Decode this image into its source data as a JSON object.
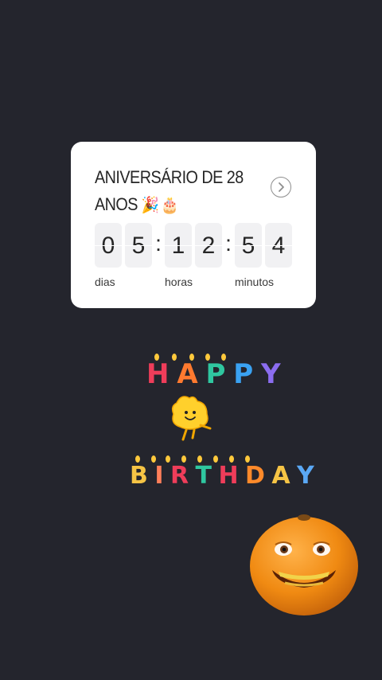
{
  "countdown": {
    "title_line1": "ANIVERSÁRIO DE 28",
    "title_line2": "ANOS",
    "title_emojis": "🎉🎂",
    "digits": [
      "0",
      "5",
      "1",
      "2",
      "5",
      "4"
    ],
    "separator": ":",
    "units": {
      "days": "dias",
      "hours": "horas",
      "minutes": "minutos"
    }
  },
  "stickers": {
    "happy": [
      "H",
      "A",
      "P",
      "P",
      "Y"
    ],
    "birthday": [
      "B",
      "I",
      "R",
      "T",
      "H",
      "D",
      "A",
      "Y"
    ]
  },
  "colors": {
    "background": "#24252d",
    "card": "#ffffff",
    "digit_box": "#f1f1f3"
  },
  "icons": {
    "arrow": "chevron-right-circle-icon",
    "mascot": "yellow-blob-mascot",
    "orange": "annoying-orange-face"
  }
}
